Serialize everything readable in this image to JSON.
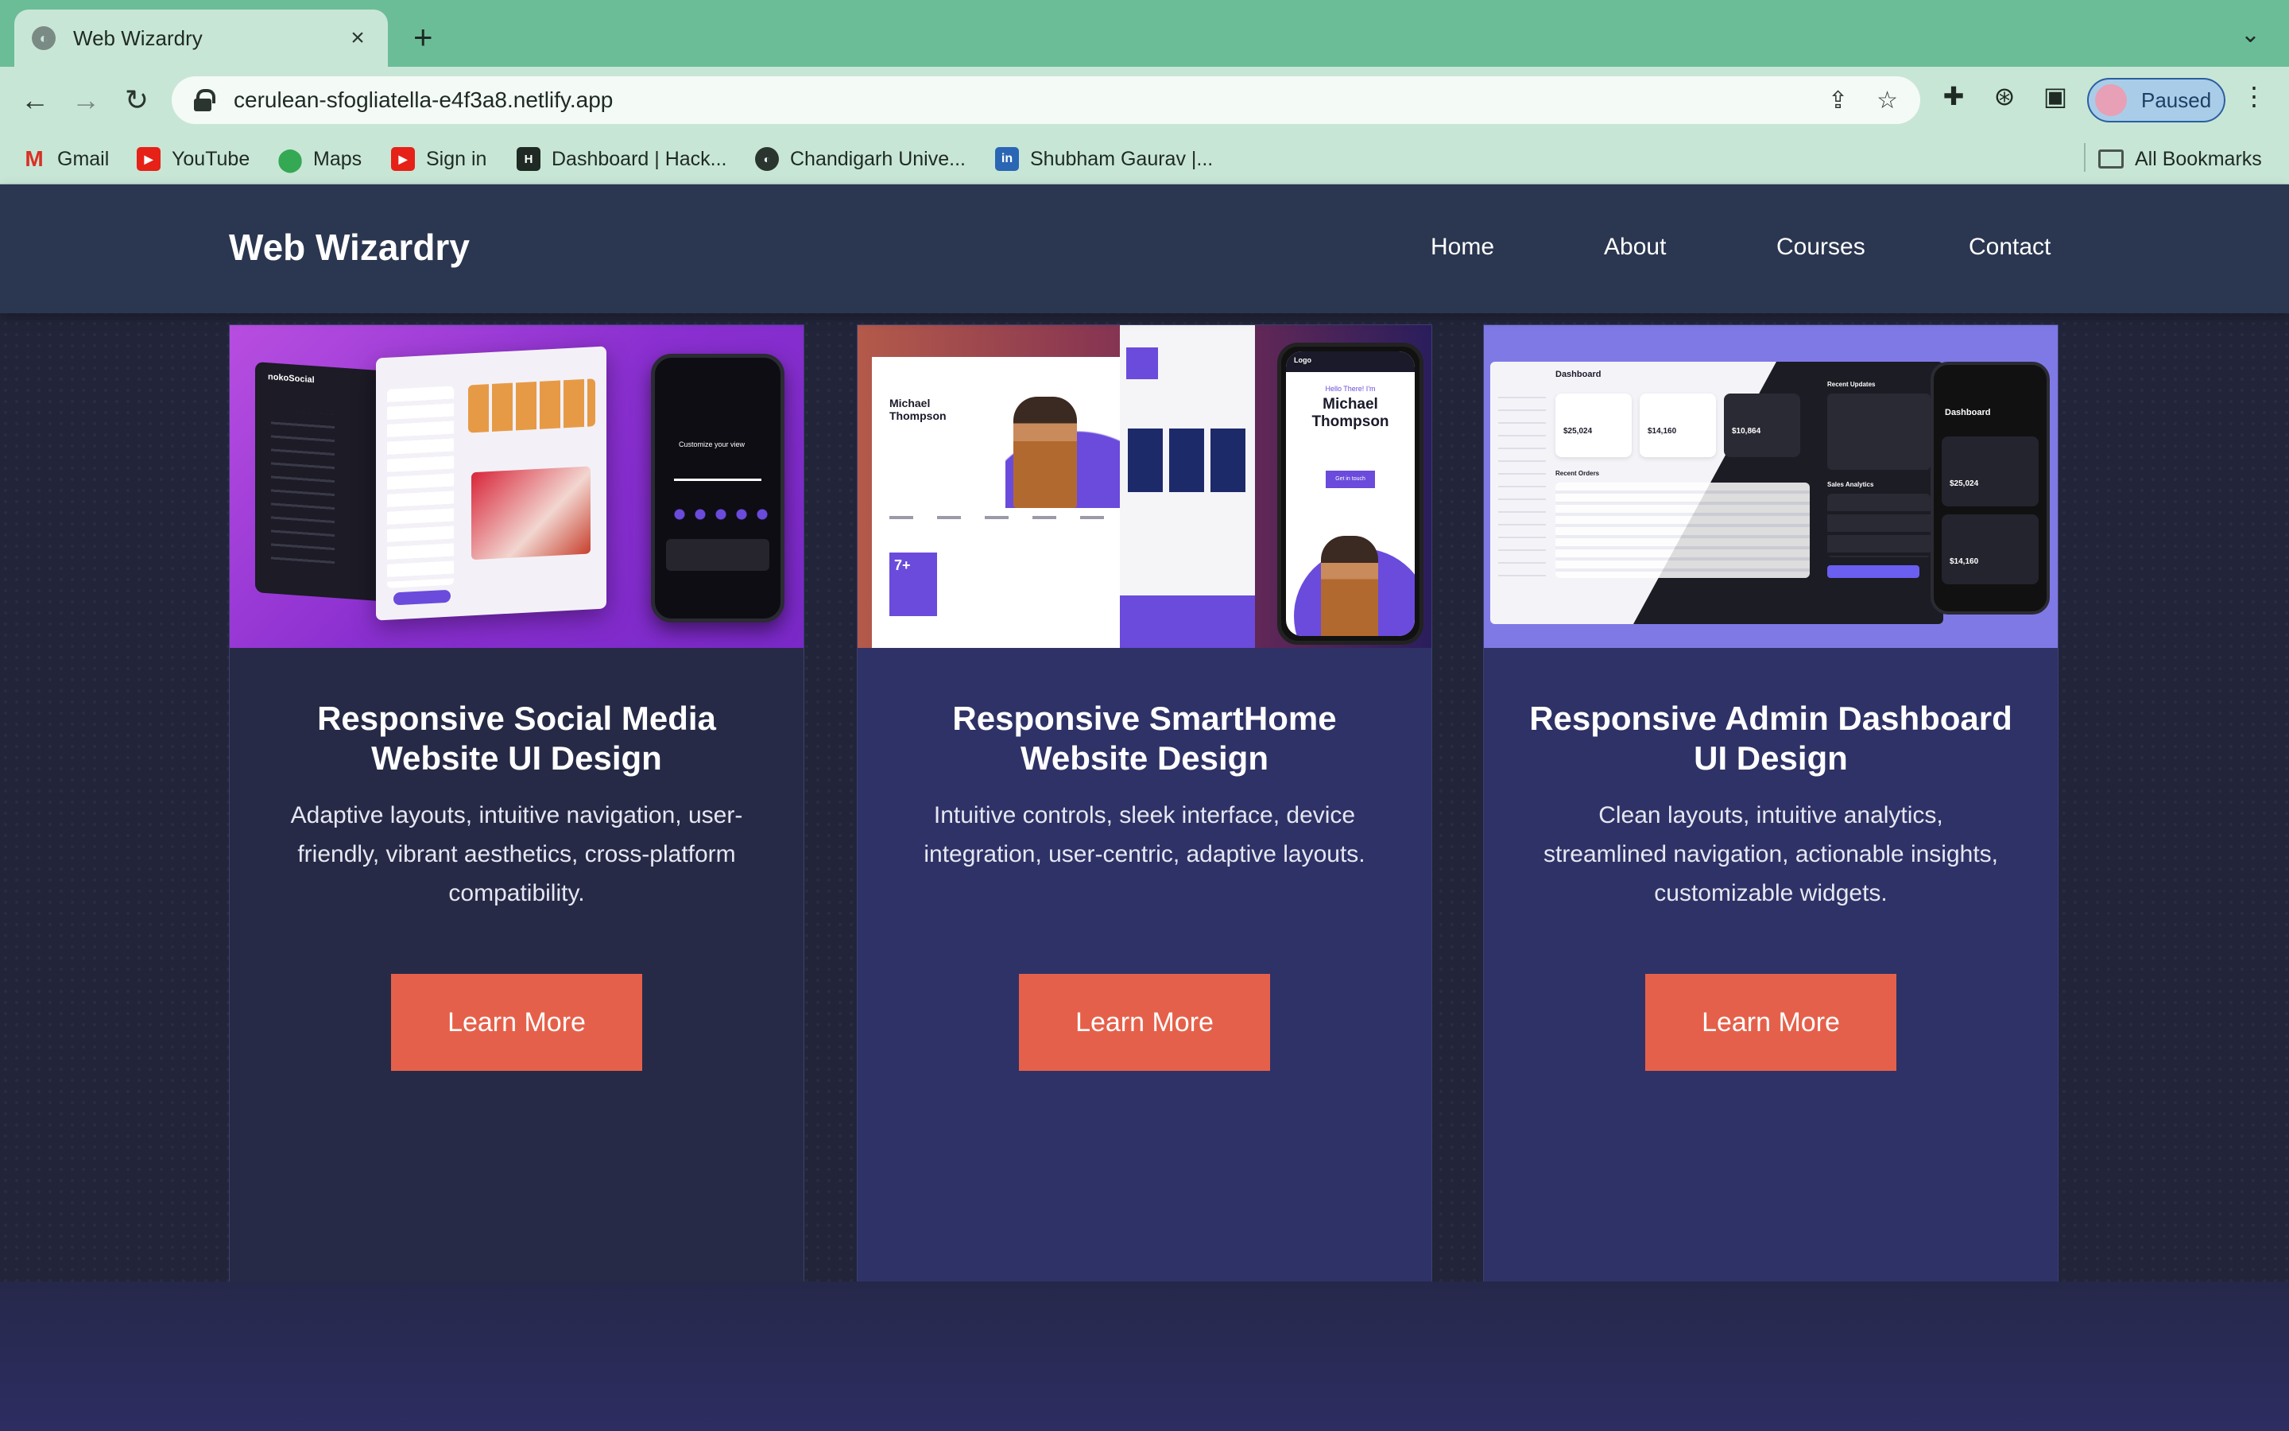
{
  "browser": {
    "tab_title": "Web Wizardry",
    "url": "cerulean-sfogliatella-e4f3a8.netlify.app",
    "profile_label": "Paused",
    "bookmarks": [
      {
        "label": "Gmail",
        "icon": "gmail-icon"
      },
      {
        "label": "YouTube",
        "icon": "youtube-icon"
      },
      {
        "label": "Maps",
        "icon": "maps-icon"
      },
      {
        "label": "Sign in",
        "icon": "youtube-icon"
      },
      {
        "label": "Dashboard | Hack...",
        "icon": "hackerrank-icon"
      },
      {
        "label": "Chandigarh Unive...",
        "icon": "globe-icon"
      },
      {
        "label": "Shubham Gaurav |...",
        "icon": "linkedin-icon"
      }
    ],
    "all_bookmarks": "All Bookmarks"
  },
  "site": {
    "logo": "Web Wizardry",
    "nav": [
      "Home",
      "About",
      "Courses",
      "Contact"
    ]
  },
  "cards": [
    {
      "title": "Responsive Social Media Website UI Design",
      "description": "Adaptive layouts, intuitive navigation, user-friendly, vibrant aesthetics, cross-platform compatibility.",
      "button": "Learn More",
      "thumb": {
        "brand": "nokoSocial",
        "phone_heading": "Customize your view"
      }
    },
    {
      "title": "Responsive SmartHome Website Design",
      "description": "Intuitive controls, sleek interface, device integration, user-centric, adaptive layouts.",
      "button": "Learn More",
      "thumb": {
        "name": "Michael Thompson",
        "greeting": "Hello There! I'm",
        "stat": "7+",
        "logo": "Logo",
        "cta": "Get in touch"
      }
    },
    {
      "title": "Responsive Admin Dashboard UI Design",
      "description": "Clean layouts, intuitive analytics, streamlined navigation, actionable insights, customizable widgets.",
      "button": "Learn More",
      "thumb": {
        "heading": "Dashboard",
        "total_sales": "$25,024",
        "total_expenses": "$14,160",
        "total_income": "$10,864",
        "recent_orders": "Recent Orders",
        "recent_updates": "Recent Updates",
        "sales_analytics": "Sales Analytics"
      }
    }
  ],
  "colors": {
    "accent": "#e5604a",
    "header": "#2b3650",
    "card": "#2f3266",
    "tabbar": "#6bbd98"
  }
}
